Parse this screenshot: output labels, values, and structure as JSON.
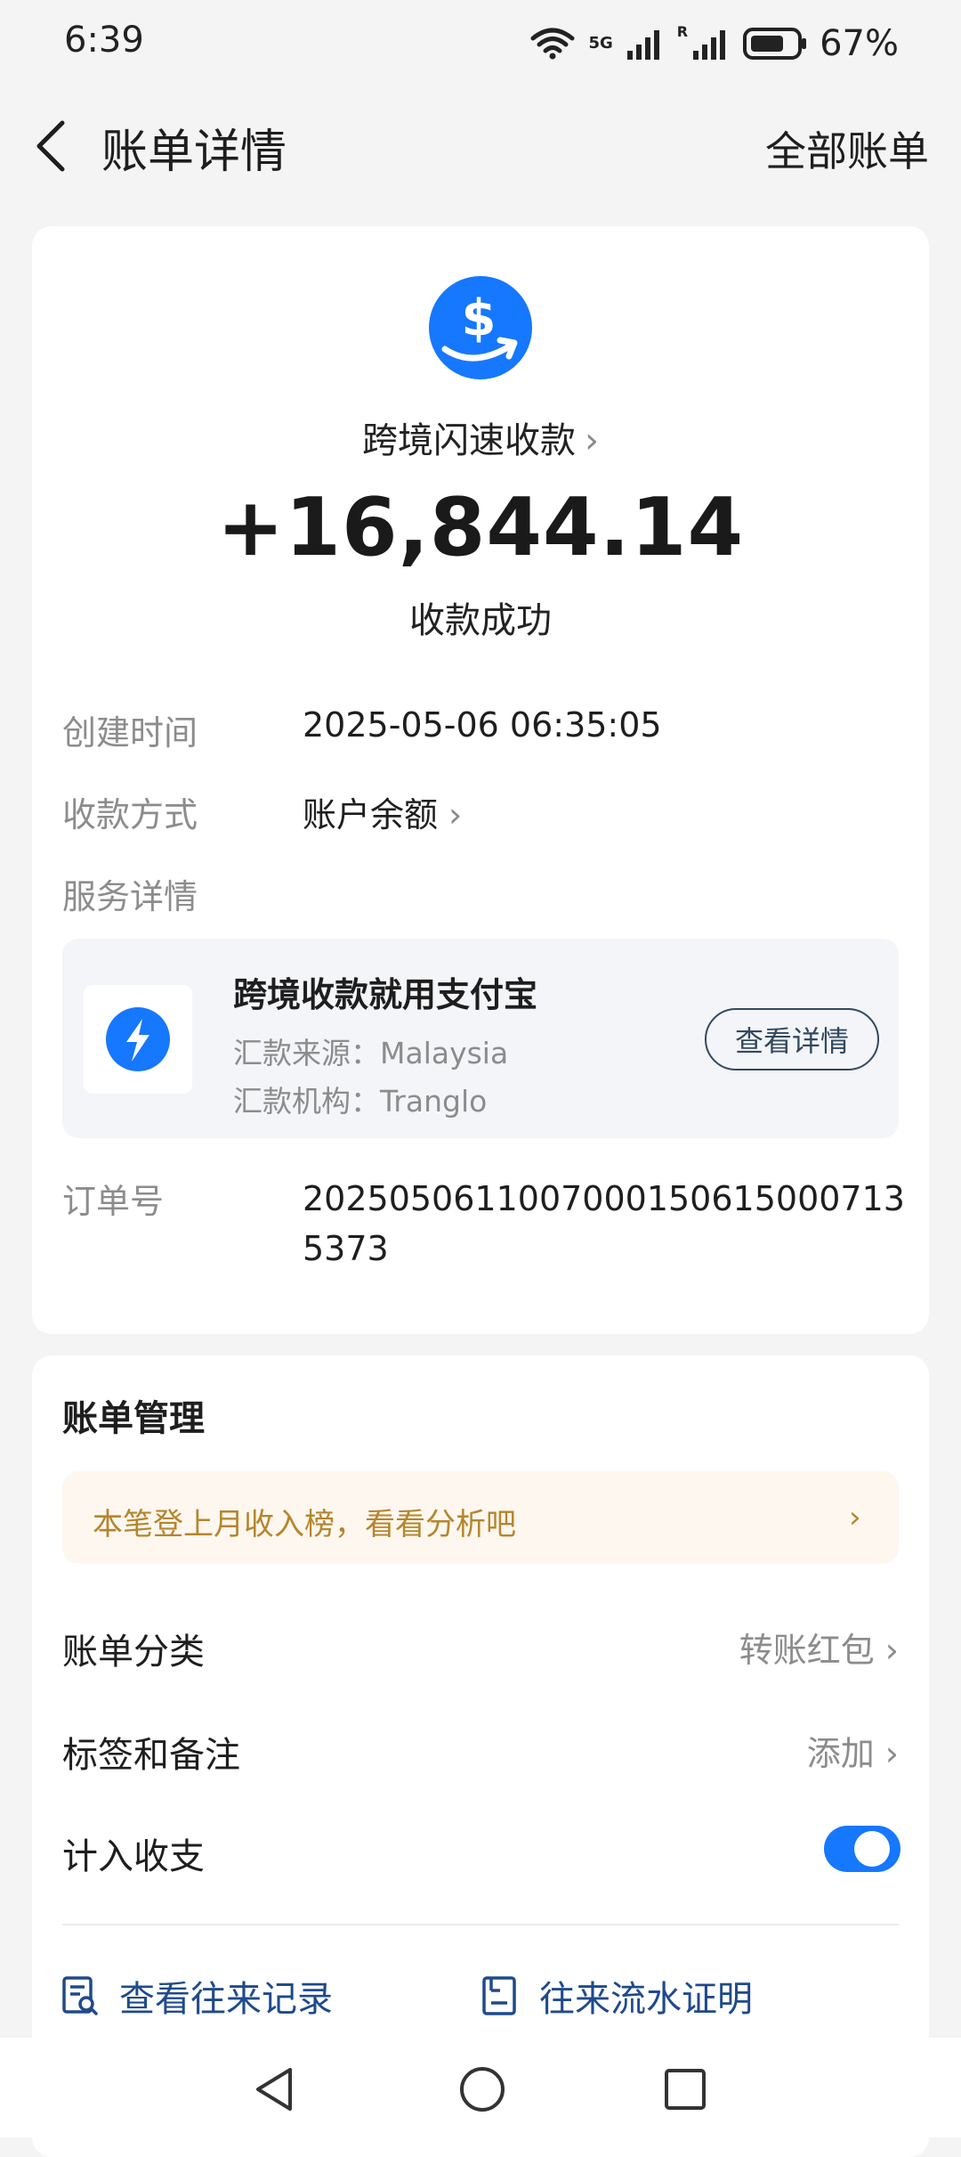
{
  "status_bar": {
    "time": "6:39",
    "network": "5G",
    "roaming": "R",
    "battery": "67%"
  },
  "header": {
    "title": "账单详情",
    "action": "全部账单",
    "back_icon": "back-arrow-icon"
  },
  "summary": {
    "merchant": "跨境闪速收款",
    "amount": "+16,844.14",
    "status": "收款成功",
    "logo_icon": "dollar-transfer-icon",
    "brand_color": "#1677ff"
  },
  "details": {
    "created_label": "创建时间",
    "created_value": "2025-05-06 06:35:05",
    "method_label": "收款方式",
    "method_value": "账户余额",
    "service_label": "服务详情",
    "order_label": "订单号",
    "order_value": "20250506110070001506150007135373"
  },
  "service_card": {
    "title": "跨境收款就用支付宝",
    "source": "汇款来源：Malaysia",
    "institution": "汇款机构：Tranglo",
    "button": "查看详情",
    "icon": "lightning-icon"
  },
  "management": {
    "title": "账单管理",
    "notice": "本笔登上月收入榜，看看分析吧",
    "category_label": "账单分类",
    "category_value": "转账红包",
    "tag_label": "标签和备注",
    "tag_value": "添加",
    "include_label": "计入收支",
    "include_enabled": true,
    "link_records": "查看往来记录",
    "link_proof": "往来流水证明"
  },
  "nav": {
    "back": "triangle-back-icon",
    "home": "circle-home-icon",
    "recent": "square-recent-icon"
  }
}
